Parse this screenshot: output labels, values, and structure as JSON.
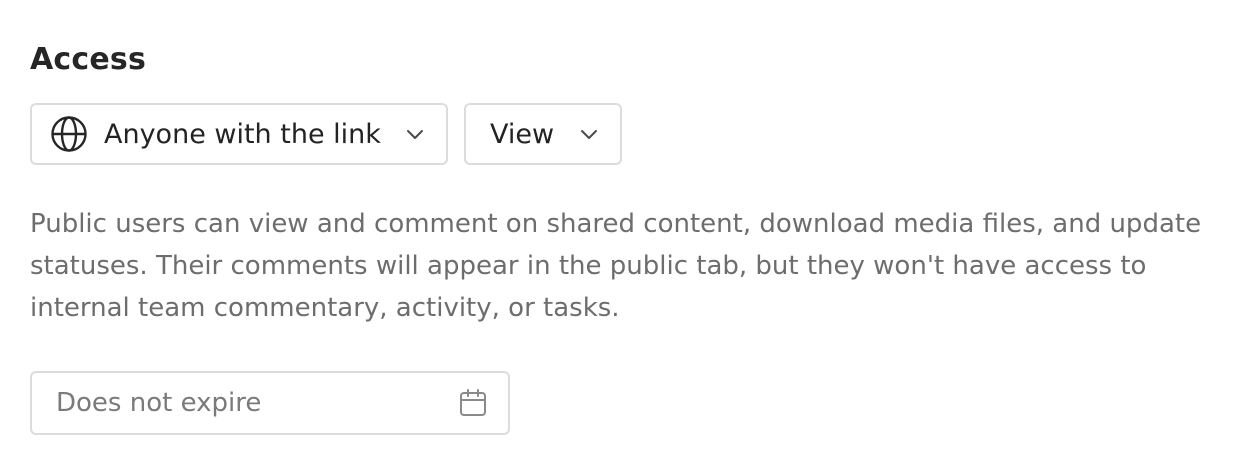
{
  "section": {
    "title": "Access"
  },
  "link_access": {
    "selected": "Anyone with the link",
    "icon": "globe-icon"
  },
  "permission": {
    "selected": "View",
    "icon": "chevron-down-icon"
  },
  "description": "Public users can view and comment on shared content, download media files, and update statuses. Their comments will appear in the public tab, but they won't have access to internal team commentary, activity, or tasks.",
  "expiry": {
    "placeholder": "Does not expire",
    "icon": "calendar-icon"
  }
}
